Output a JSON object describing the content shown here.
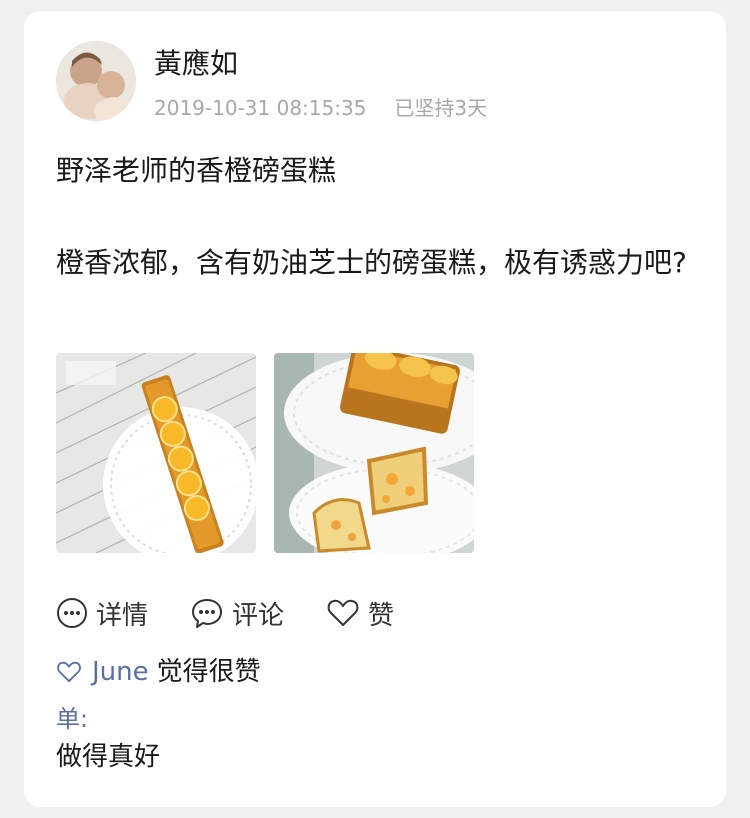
{
  "post": {
    "author_name": "黃應如",
    "timestamp": "2019-10-31 08:15:35",
    "streak": "已坚持3天",
    "title": "野泽老师的香橙磅蛋糕",
    "body": "橙香浓郁，含有奶油芝士的磅蛋糕，极有诱惑力吧?"
  },
  "actions": {
    "details_label": "详情",
    "comment_label": "评论",
    "like_label": "赞"
  },
  "likes": {
    "liker_name": "June",
    "liked_text": "觉得很赞"
  },
  "comment": {
    "author": "单:",
    "text": "做得真好"
  },
  "icons": {
    "details": "more-circle-icon",
    "comment": "chat-bubble-icon",
    "like": "heart-icon",
    "liked": "heart-outline-icon"
  },
  "colors": {
    "link": "#5a6fa6",
    "meta": "#a8a8a8",
    "background": "#f0f0f0"
  }
}
